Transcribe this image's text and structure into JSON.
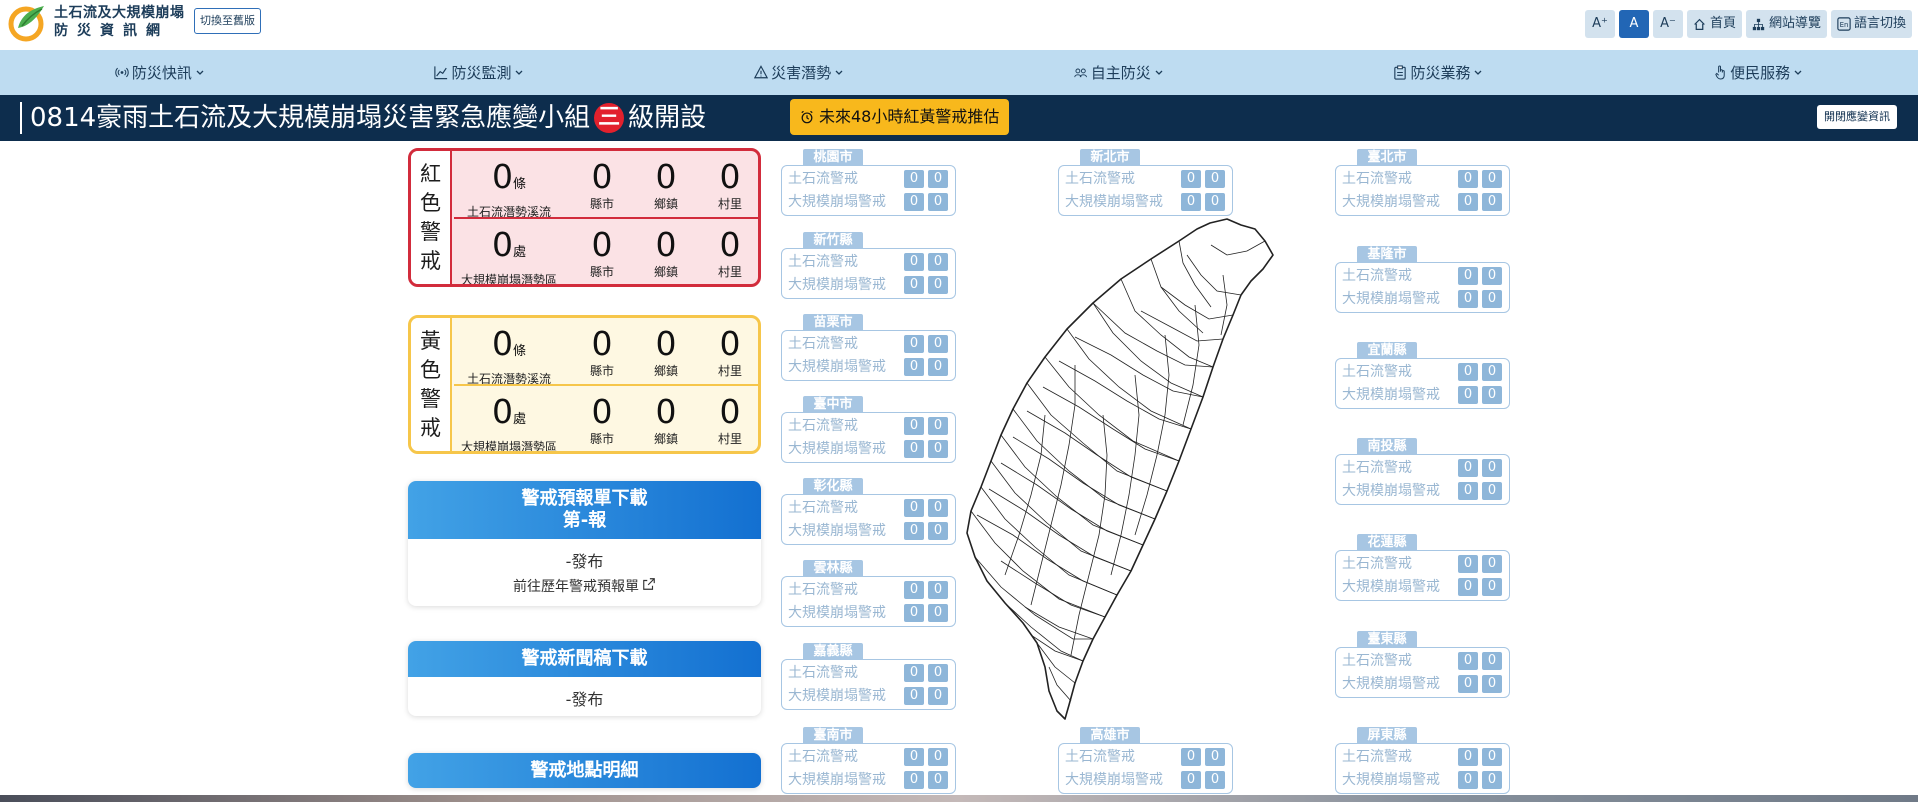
{
  "header": {
    "site_title_line1": "土石流及大規模崩塌",
    "site_title_line2": "防災資訊網",
    "switch_label": "切換至舊版",
    "tools": {
      "font_larger": "A⁺",
      "font_normal": "A",
      "font_smaller": "A⁻",
      "home": "首頁",
      "sitemap": "網站導覽",
      "language": "語言切換"
    }
  },
  "nav": [
    {
      "label": "防災快訊",
      "icon": "broadcast-icon"
    },
    {
      "label": "防災監測",
      "icon": "chart-line-icon"
    },
    {
      "label": "災害潛勢",
      "icon": "warning-triangle-icon"
    },
    {
      "label": "自主防災",
      "icon": "people-icon"
    },
    {
      "label": "防災業務",
      "icon": "clipboard-icon"
    },
    {
      "label": "便民服務",
      "icon": "hand-pointer-icon"
    }
  ],
  "banner": {
    "title": "0814豪雨土石流及大規模崩塌災害緊急應變小組",
    "level": "三",
    "title_suffix": "級開設",
    "forecast_label": "未來48小時紅黃警戒推估",
    "open_info_label": "開閉應變資訊"
  },
  "alerts": {
    "red": {
      "label": [
        "紅",
        "色",
        "警",
        "戒"
      ],
      "rows": [
        {
          "count": "0",
          "unit": "條",
          "desc": "土石流潛勢溪流",
          "county": "0",
          "county_label": "縣市",
          "town": "0",
          "town_label": "鄉鎮",
          "village": "0",
          "village_label": "村里"
        },
        {
          "count": "0",
          "unit": "處",
          "desc": "大規模崩塌潛勢區",
          "county": "0",
          "county_label": "縣市",
          "town": "0",
          "town_label": "鄉鎮",
          "village": "0",
          "village_label": "村里"
        }
      ]
    },
    "yellow": {
      "label": [
        "黃",
        "色",
        "警",
        "戒"
      ],
      "rows": [
        {
          "count": "0",
          "unit": "條",
          "desc": "土石流潛勢溪流",
          "county": "0",
          "county_label": "縣市",
          "town": "0",
          "town_label": "鄉鎮",
          "village": "0",
          "village_label": "村里"
        },
        {
          "count": "0",
          "unit": "處",
          "desc": "大規模崩塌潛勢區",
          "county": "0",
          "county_label": "縣市",
          "town": "0",
          "town_label": "鄉鎮",
          "village": "0",
          "village_label": "村里"
        }
      ]
    }
  },
  "cards": {
    "forecast": {
      "title1": "警戒預報單下載",
      "title2": "第-報",
      "status": "-發布",
      "link": "前往歷年警戒預報單"
    },
    "news": {
      "title": "警戒新聞稿下載",
      "status": "-發布"
    },
    "locations": {
      "title": "警戒地點明細"
    }
  },
  "county_row_labels": {
    "debris": "土石流警戒",
    "landslide": "大規模崩塌警戒"
  },
  "counties": [
    {
      "name": "桃園市",
      "debris": [
        "0",
        "0"
      ],
      "landslide": [
        "0",
        "0"
      ]
    },
    {
      "name": "新竹縣",
      "debris": [
        "0",
        "0"
      ],
      "landslide": [
        "0",
        "0"
      ]
    },
    {
      "name": "苗栗市",
      "debris": [
        "0",
        "0"
      ],
      "landslide": [
        "0",
        "0"
      ]
    },
    {
      "name": "臺中市",
      "debris": [
        "0",
        "0"
      ],
      "landslide": [
        "0",
        "0"
      ]
    },
    {
      "name": "彰化縣",
      "debris": [
        "0",
        "0"
      ],
      "landslide": [
        "0",
        "0"
      ]
    },
    {
      "name": "雲林縣",
      "debris": [
        "0",
        "0"
      ],
      "landslide": [
        "0",
        "0"
      ]
    },
    {
      "name": "嘉義縣",
      "debris": [
        "0",
        "0"
      ],
      "landslide": [
        "0",
        "0"
      ]
    },
    {
      "name": "臺南市",
      "debris": [
        "0",
        "0"
      ],
      "landslide": [
        "0",
        "0"
      ]
    },
    {
      "name": "新北市",
      "debris": [
        "0",
        "0"
      ],
      "landslide": [
        "0",
        "0"
      ]
    },
    {
      "name": "高雄市",
      "debris": [
        "0",
        "0"
      ],
      "landslide": [
        "0",
        "0"
      ]
    },
    {
      "name": "臺北市",
      "debris": [
        "0",
        "0"
      ],
      "landslide": [
        "0",
        "0"
      ]
    },
    {
      "name": "基隆市",
      "debris": [
        "0",
        "0"
      ],
      "landslide": [
        "0",
        "0"
      ]
    },
    {
      "name": "宜蘭縣",
      "debris": [
        "0",
        "0"
      ],
      "landslide": [
        "0",
        "0"
      ]
    },
    {
      "name": "南投縣",
      "debris": [
        "0",
        "0"
      ],
      "landslide": [
        "0",
        "0"
      ]
    },
    {
      "name": "花蓮縣",
      "debris": [
        "0",
        "0"
      ],
      "landslide": [
        "0",
        "0"
      ]
    },
    {
      "name": "臺東縣",
      "debris": [
        "0",
        "0"
      ],
      "landslide": [
        "0",
        "0"
      ]
    },
    {
      "name": "屏東縣",
      "debris": [
        "0",
        "0"
      ],
      "landslide": [
        "0",
        "0"
      ]
    }
  ],
  "colors": {
    "banner_bg": "#0d2d4d",
    "nav_bg": "#bedcf1",
    "red_alert": "#d22c3c",
    "yellow_alert": "#f6c64a",
    "forecast_button": "#f8b81c",
    "card_header": "#1370d1"
  }
}
